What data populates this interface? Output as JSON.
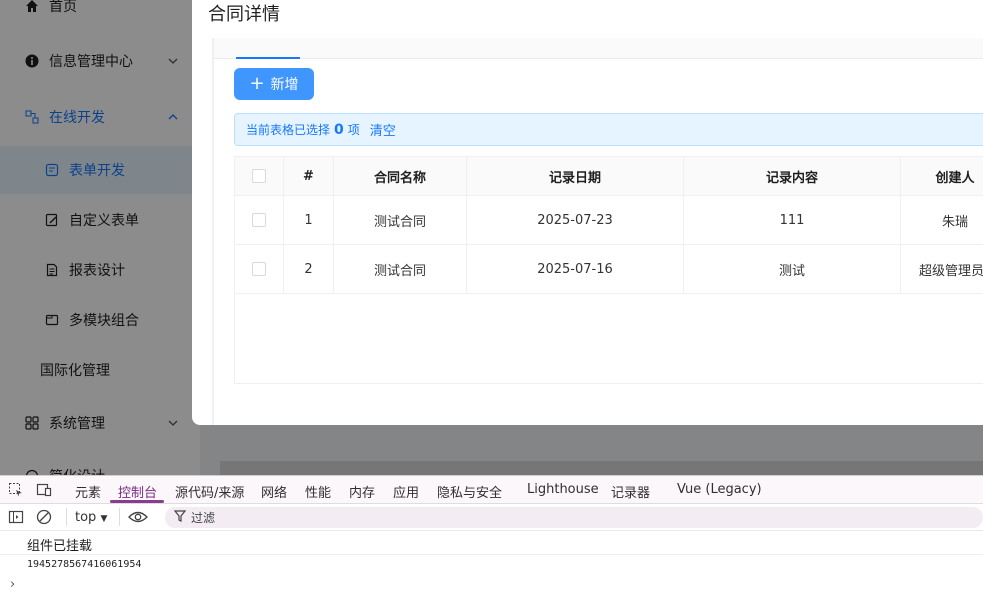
{
  "sidebar": {
    "items": [
      {
        "label": "首页",
        "icon": "home-icon"
      },
      {
        "label": "信息管理中心",
        "icon": "info-icon"
      },
      {
        "label": "在线开发",
        "icon": "dev-icon"
      },
      {
        "label": "表单开发",
        "icon": "form-icon"
      },
      {
        "label": "自定义表单",
        "icon": "edit-form-icon"
      },
      {
        "label": "报表设计",
        "icon": "report-icon"
      },
      {
        "label": "多模块组合",
        "icon": "module-icon"
      },
      {
        "label": "国际化管理",
        "icon": ""
      },
      {
        "label": "系统管理",
        "icon": "apps-icon"
      },
      {
        "label": "简化设计",
        "icon": ""
      }
    ]
  },
  "modal": {
    "title": "合同详情",
    "add_button": "新增",
    "alert": {
      "prefix": "当前表格已选择",
      "count": "0",
      "suffix": "项",
      "clear": "清空"
    },
    "table": {
      "columns": [
        "#",
        "合同名称",
        "记录日期",
        "记录内容",
        "创建人"
      ],
      "rows": [
        {
          "index": "1",
          "name": "测试合同",
          "date": "2025-07-23",
          "content": "111",
          "creator": "朱瑞"
        },
        {
          "index": "2",
          "name": "测试合同",
          "date": "2025-07-16",
          "content": "测试",
          "creator": "超级管理员"
        }
      ]
    }
  },
  "devtools": {
    "tabs": [
      "元素",
      "控制台",
      "源代码/来源",
      "网络",
      "性能",
      "内存",
      "应用",
      "隐私与安全",
      "Lighthouse",
      "记录器",
      "Vue (Legacy)"
    ],
    "active_tab": "控制台",
    "context": "top",
    "filter_placeholder": "过滤",
    "console": [
      "组件已挂载",
      "1945278567416061954"
    ],
    "prompt": "›"
  },
  "colors": {
    "primary": "#1677ff",
    "button": "#4096ff",
    "devtools_accent": "#8a3d8f"
  }
}
